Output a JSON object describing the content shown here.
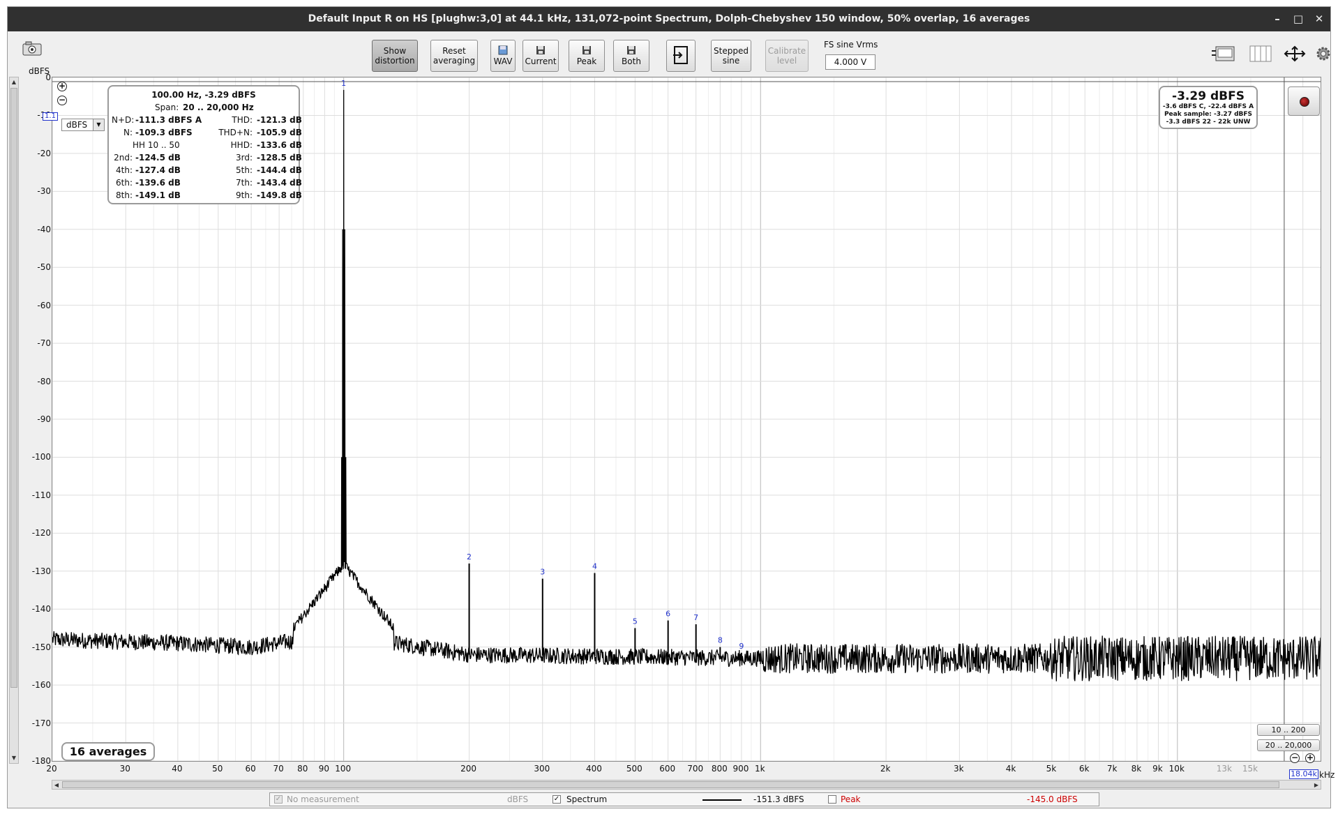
{
  "window": {
    "title": "Default Input R on HS [plughw:3,0] at 44.1 kHz, 131,072-point Spectrum, Dolph-Chebyshev 150 window, 50% overlap, 16 averages",
    "minimize": "–",
    "maximize": "□",
    "close": "✕"
  },
  "toolbar": {
    "show_distortion": [
      "Show",
      "distortion"
    ],
    "reset_averaging": [
      "Reset",
      "averaging"
    ],
    "wav": "WAV",
    "current": "Current",
    "peak": "Peak",
    "both": "Both",
    "stepped_sine": [
      "Stepped",
      "sine"
    ],
    "calibrate_level": [
      "Calibrate",
      "level"
    ],
    "fs_label": "FS sine Vrms",
    "fs_value": "4.000 V"
  },
  "axes": {
    "y_unit": "dBFS",
    "unit_select": "dBFS",
    "ref_marker": "1.1",
    "x_unit": "kHz",
    "cursor_label": "18.04k"
  },
  "readout": {
    "header": "100.00 Hz, -3.29 dBFS",
    "span_label": "Span:",
    "span_value": "20 .. 20,000 Hz",
    "nd_label": "N+D:",
    "nd_value": "-111.3 dBFS A",
    "thd_label": "THD:",
    "thd_value": "-121.3 dB",
    "n_label": "N:",
    "n_value": "-109.3 dBFS",
    "thdn_label": "THD+N:",
    "thdn_value": "-105.9 dB",
    "hh_label": "HH 10 .. 50",
    "hhd_label": "HHD:",
    "hhd_value": "-133.6 dB",
    "h2_label": "2nd:",
    "h2_value": "-124.5 dB",
    "h3_label": "3rd:",
    "h3_value": "-128.5 dB",
    "h4_label": "4th:",
    "h4_value": "-127.4 dB",
    "h5_label": "5th:",
    "h5_value": "-144.4 dB",
    "h6_label": "6th:",
    "h6_value": "-139.6 dB",
    "h7_label": "7th:",
    "h7_value": "-143.4 dB",
    "h8_label": "8th:",
    "h8_value": "-149.1 dB",
    "h9_label": "9th:",
    "h9_value": "-149.8 dB"
  },
  "level": {
    "main": "-3.29 dBFS",
    "line1": "-3.6 dBFS C, -22.4 dBFS A",
    "line2": "Peak sample: -3.27 dBFS",
    "line3": "-3.3 dBFS 22 - 22k UNW"
  },
  "averages_badge": "16 averages",
  "zoom": {
    "range1": "10 .. 200",
    "range2": "20 .. 20,000"
  },
  "legend": {
    "no_measurement": "No measurement",
    "no_measurement_unit": "dBFS",
    "spectrum": "Spectrum",
    "spectrum_value": "-151.3 dBFS",
    "peak": "Peak",
    "peak_value": "-145.0 dBFS",
    "spectrum_color": "#000000",
    "peak_color": "#cc0000",
    "harmonic_label_color": "#2233cc"
  },
  "chart_data": {
    "type": "line",
    "x_scale": "log",
    "xlim": [
      20,
      22050
    ],
    "ylim": [
      -180,
      0
    ],
    "grid": true,
    "y_ticks": [
      0,
      -10,
      -20,
      -30,
      -40,
      -50,
      -60,
      -70,
      -80,
      -90,
      -100,
      -110,
      -120,
      -130,
      -140,
      -150,
      -160,
      -170,
      -180
    ],
    "x_ticks": [
      {
        "v": 20,
        "t": "20"
      },
      {
        "v": 30,
        "t": "30"
      },
      {
        "v": 40,
        "t": "40"
      },
      {
        "v": 50,
        "t": "50"
      },
      {
        "v": 60,
        "t": "60"
      },
      {
        "v": 70,
        "t": "70"
      },
      {
        "v": 80,
        "t": "80"
      },
      {
        "v": 90,
        "t": "90"
      },
      {
        "v": 100,
        "t": "100"
      },
      {
        "v": 200,
        "t": "200"
      },
      {
        "v": 300,
        "t": "300"
      },
      {
        "v": 400,
        "t": "400"
      },
      {
        "v": 500,
        "t": "500"
      },
      {
        "v": 600,
        "t": "600"
      },
      {
        "v": 700,
        "t": "700"
      },
      {
        "v": 800,
        "t": "800"
      },
      {
        "v": 900,
        "t": "900"
      },
      {
        "v": 1000,
        "t": "1k"
      },
      {
        "v": 2000,
        "t": "2k"
      },
      {
        "v": 3000,
        "t": "3k"
      },
      {
        "v": 4000,
        "t": "4k"
      },
      {
        "v": 5000,
        "t": "5k"
      },
      {
        "v": 6000,
        "t": "6k"
      },
      {
        "v": 7000,
        "t": "7k"
      },
      {
        "v": 8000,
        "t": "8k"
      },
      {
        "v": 9000,
        "t": "9k"
      },
      {
        "v": 10000,
        "t": "10k"
      },
      {
        "v": 13000,
        "t": "13k",
        "faded": true
      },
      {
        "v": 15000,
        "t": "15k",
        "faded": true
      }
    ],
    "fundamental": {
      "x": 100,
      "y": -3.29
    },
    "harmonics": [
      {
        "label": "1",
        "x": 100,
        "y": -3.29
      },
      {
        "label": "2",
        "x": 200,
        "y": -128
      },
      {
        "label": "3",
        "x": 300,
        "y": -132
      },
      {
        "label": "4",
        "x": 400,
        "y": -130.5
      },
      {
        "label": "5",
        "x": 500,
        "y": -145
      },
      {
        "label": "6",
        "x": 600,
        "y": -143
      },
      {
        "label": "7",
        "x": 700,
        "y": -144
      },
      {
        "label": "8",
        "x": 800,
        "y": -150
      },
      {
        "label": "9",
        "x": 900,
        "y": -151.5
      }
    ],
    "reference_level": -1.1,
    "cursor_x": 18040,
    "noise_floor": [
      {
        "x": 20,
        "y": -148
      },
      {
        "x": 40,
        "y": -149
      },
      {
        "x": 60,
        "y": -150
      },
      {
        "x": 80,
        "y": -148
      },
      {
        "x": 90,
        "y": -146
      },
      {
        "x": 200,
        "y": -152
      },
      {
        "x": 1000,
        "y": -153
      },
      {
        "x": 5000,
        "y": -153
      },
      {
        "x": 22050,
        "y": -153
      }
    ]
  }
}
